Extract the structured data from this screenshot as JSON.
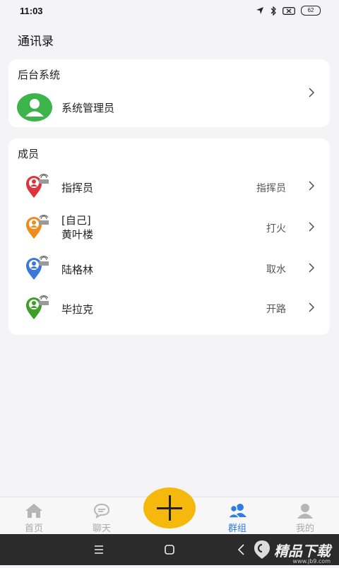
{
  "status": {
    "time": "11:03",
    "battery": "62"
  },
  "page": {
    "title": "通讯录"
  },
  "system_section": {
    "title": "后台系统",
    "admin": {
      "name": "系统管理员",
      "icon": "user-icon",
      "color": "#3cb44b"
    }
  },
  "members_section": {
    "title": "成员",
    "members": [
      {
        "name": "指挥员",
        "role": "指挥员",
        "color": "#e0323c"
      },
      {
        "name_line1": "[自己]",
        "name_line2": "黄叶楼",
        "role": "打火",
        "color": "#f08c1e"
      },
      {
        "name": "陆格林",
        "role": "取水",
        "color": "#3c78dc"
      },
      {
        "name": "毕拉克",
        "role": "开路",
        "color": "#3ca028"
      }
    ]
  },
  "tabbar": {
    "tabs": [
      {
        "label": "首页",
        "icon": "home-icon"
      },
      {
        "label": "聊天",
        "icon": "chat-icon"
      },
      {
        "label": "群组",
        "icon": "group-icon",
        "active": true
      },
      {
        "label": "我的",
        "icon": "profile-icon"
      }
    ],
    "fab_icon": "plus-icon",
    "active_color": "#2f7de1",
    "fab_color": "#f5b80c"
  },
  "watermark": {
    "text": "精品下载",
    "sub": "www.jb9.com"
  }
}
